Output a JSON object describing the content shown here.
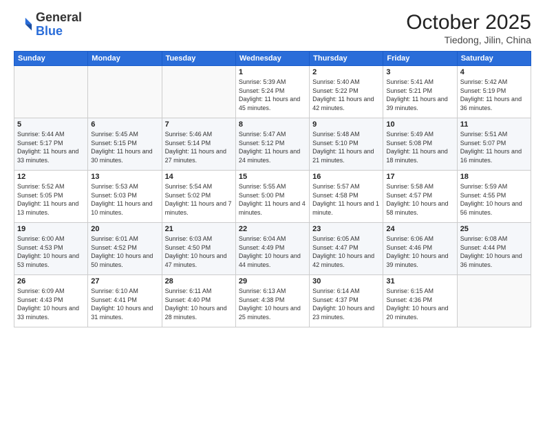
{
  "header": {
    "logo_general": "General",
    "logo_blue": "Blue",
    "month_title": "October 2025",
    "subtitle": "Tiedong, Jilin, China"
  },
  "days_of_week": [
    "Sunday",
    "Monday",
    "Tuesday",
    "Wednesday",
    "Thursday",
    "Friday",
    "Saturday"
  ],
  "weeks": [
    [
      {
        "day": "",
        "info": ""
      },
      {
        "day": "",
        "info": ""
      },
      {
        "day": "",
        "info": ""
      },
      {
        "day": "1",
        "info": "Sunrise: 5:39 AM\nSunset: 5:24 PM\nDaylight: 11 hours and 45 minutes."
      },
      {
        "day": "2",
        "info": "Sunrise: 5:40 AM\nSunset: 5:22 PM\nDaylight: 11 hours and 42 minutes."
      },
      {
        "day": "3",
        "info": "Sunrise: 5:41 AM\nSunset: 5:21 PM\nDaylight: 11 hours and 39 minutes."
      },
      {
        "day": "4",
        "info": "Sunrise: 5:42 AM\nSunset: 5:19 PM\nDaylight: 11 hours and 36 minutes."
      }
    ],
    [
      {
        "day": "5",
        "info": "Sunrise: 5:44 AM\nSunset: 5:17 PM\nDaylight: 11 hours and 33 minutes."
      },
      {
        "day": "6",
        "info": "Sunrise: 5:45 AM\nSunset: 5:15 PM\nDaylight: 11 hours and 30 minutes."
      },
      {
        "day": "7",
        "info": "Sunrise: 5:46 AM\nSunset: 5:14 PM\nDaylight: 11 hours and 27 minutes."
      },
      {
        "day": "8",
        "info": "Sunrise: 5:47 AM\nSunset: 5:12 PM\nDaylight: 11 hours and 24 minutes."
      },
      {
        "day": "9",
        "info": "Sunrise: 5:48 AM\nSunset: 5:10 PM\nDaylight: 11 hours and 21 minutes."
      },
      {
        "day": "10",
        "info": "Sunrise: 5:49 AM\nSunset: 5:08 PM\nDaylight: 11 hours and 18 minutes."
      },
      {
        "day": "11",
        "info": "Sunrise: 5:51 AM\nSunset: 5:07 PM\nDaylight: 11 hours and 16 minutes."
      }
    ],
    [
      {
        "day": "12",
        "info": "Sunrise: 5:52 AM\nSunset: 5:05 PM\nDaylight: 11 hours and 13 minutes."
      },
      {
        "day": "13",
        "info": "Sunrise: 5:53 AM\nSunset: 5:03 PM\nDaylight: 11 hours and 10 minutes."
      },
      {
        "day": "14",
        "info": "Sunrise: 5:54 AM\nSunset: 5:02 PM\nDaylight: 11 hours and 7 minutes."
      },
      {
        "day": "15",
        "info": "Sunrise: 5:55 AM\nSunset: 5:00 PM\nDaylight: 11 hours and 4 minutes."
      },
      {
        "day": "16",
        "info": "Sunrise: 5:57 AM\nSunset: 4:58 PM\nDaylight: 11 hours and 1 minute."
      },
      {
        "day": "17",
        "info": "Sunrise: 5:58 AM\nSunset: 4:57 PM\nDaylight: 10 hours and 58 minutes."
      },
      {
        "day": "18",
        "info": "Sunrise: 5:59 AM\nSunset: 4:55 PM\nDaylight: 10 hours and 56 minutes."
      }
    ],
    [
      {
        "day": "19",
        "info": "Sunrise: 6:00 AM\nSunset: 4:53 PM\nDaylight: 10 hours and 53 minutes."
      },
      {
        "day": "20",
        "info": "Sunrise: 6:01 AM\nSunset: 4:52 PM\nDaylight: 10 hours and 50 minutes."
      },
      {
        "day": "21",
        "info": "Sunrise: 6:03 AM\nSunset: 4:50 PM\nDaylight: 10 hours and 47 minutes."
      },
      {
        "day": "22",
        "info": "Sunrise: 6:04 AM\nSunset: 4:49 PM\nDaylight: 10 hours and 44 minutes."
      },
      {
        "day": "23",
        "info": "Sunrise: 6:05 AM\nSunset: 4:47 PM\nDaylight: 10 hours and 42 minutes."
      },
      {
        "day": "24",
        "info": "Sunrise: 6:06 AM\nSunset: 4:46 PM\nDaylight: 10 hours and 39 minutes."
      },
      {
        "day": "25",
        "info": "Sunrise: 6:08 AM\nSunset: 4:44 PM\nDaylight: 10 hours and 36 minutes."
      }
    ],
    [
      {
        "day": "26",
        "info": "Sunrise: 6:09 AM\nSunset: 4:43 PM\nDaylight: 10 hours and 33 minutes."
      },
      {
        "day": "27",
        "info": "Sunrise: 6:10 AM\nSunset: 4:41 PM\nDaylight: 10 hours and 31 minutes."
      },
      {
        "day": "28",
        "info": "Sunrise: 6:11 AM\nSunset: 4:40 PM\nDaylight: 10 hours and 28 minutes."
      },
      {
        "day": "29",
        "info": "Sunrise: 6:13 AM\nSunset: 4:38 PM\nDaylight: 10 hours and 25 minutes."
      },
      {
        "day": "30",
        "info": "Sunrise: 6:14 AM\nSunset: 4:37 PM\nDaylight: 10 hours and 23 minutes."
      },
      {
        "day": "31",
        "info": "Sunrise: 6:15 AM\nSunset: 4:36 PM\nDaylight: 10 hours and 20 minutes."
      },
      {
        "day": "",
        "info": ""
      }
    ]
  ]
}
